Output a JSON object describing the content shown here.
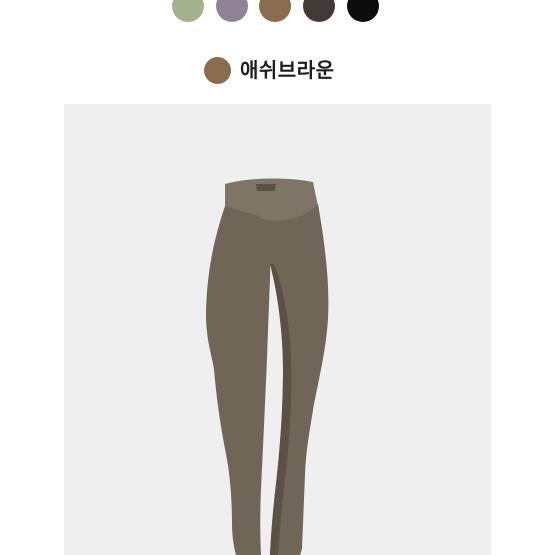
{
  "colors": {
    "page_background": "#ffffff",
    "image_background": "#efefef",
    "product_main": "#6f6658",
    "product_shadow": "#5a5246",
    "product_highlight": "#7f7566"
  },
  "swatches": [
    {
      "name": "olive-green",
      "color": "#a3b28a"
    },
    {
      "name": "lavender-gray",
      "color": "#8f8496"
    },
    {
      "name": "ash-brown",
      "color": "#8b6c4f"
    },
    {
      "name": "dark-brown",
      "color": "#433a36"
    },
    {
      "name": "black",
      "color": "#0c0c0c"
    }
  ],
  "selected": {
    "label": "애쉬브라운",
    "color": "#8b6c4f"
  },
  "product": {
    "image_icon": "leggings-image"
  }
}
